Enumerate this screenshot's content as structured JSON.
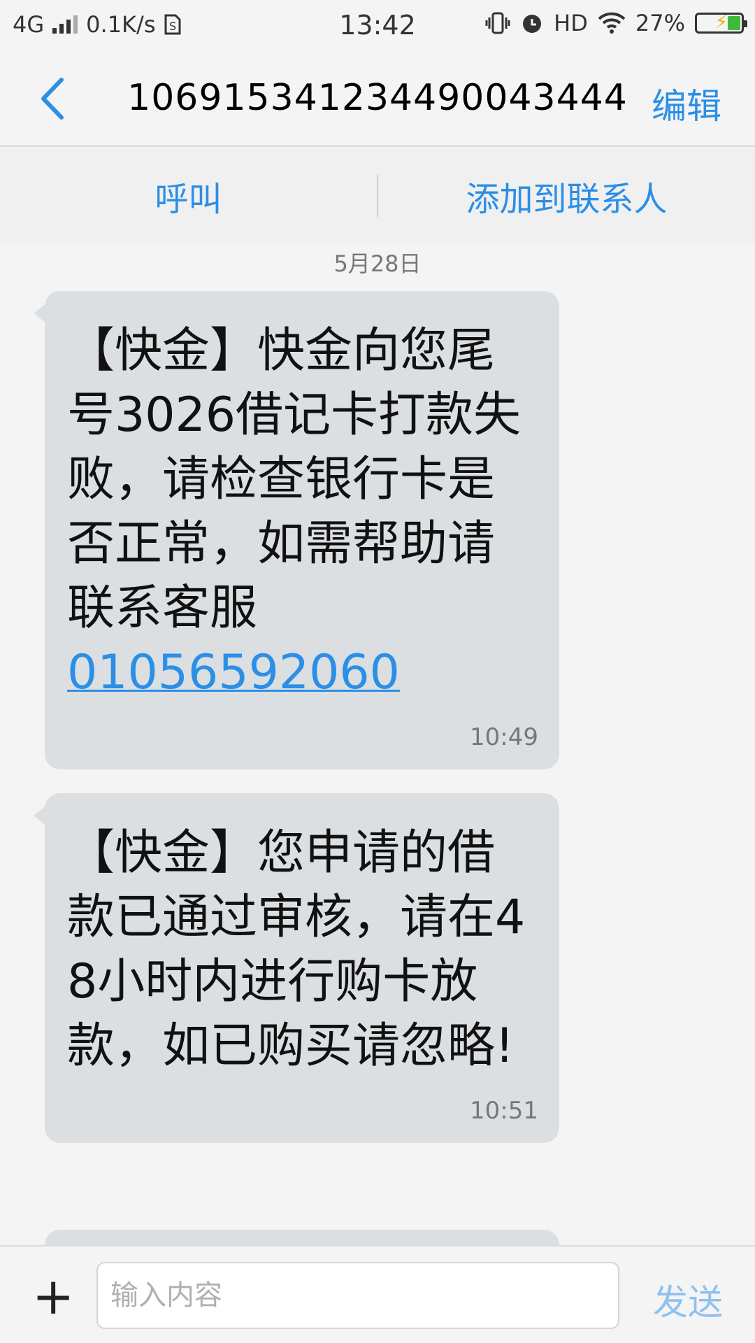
{
  "status_bar": {
    "network": "4G",
    "speed": "0.1K/s",
    "time": "13:42",
    "hd": "HD",
    "battery": "27%"
  },
  "nav": {
    "title": "106915341234490043444",
    "edit_label": "编辑"
  },
  "actions": {
    "call_label": "呼叫",
    "add_contact_label": "添加到联系人"
  },
  "thread": {
    "date": "5月28日",
    "messages": [
      {
        "text": "【快金】快金向您尾号3026借记卡打款失败，请检查银行卡是否正常，如需帮助请联系客服",
        "link": "01056592060",
        "time": "10:49"
      },
      {
        "text": "【快金】您申请的借款已通过审核，请在48小时内进行购卡放款，如已购买请忽略!",
        "time": "10:51"
      }
    ]
  },
  "composer": {
    "plus": "+",
    "placeholder": "输入内容",
    "send_label": "发送"
  },
  "colors": {
    "accent": "#2b8fe6",
    "bubble": "#dcdfe2",
    "send_disabled": "#8fc1ee"
  }
}
